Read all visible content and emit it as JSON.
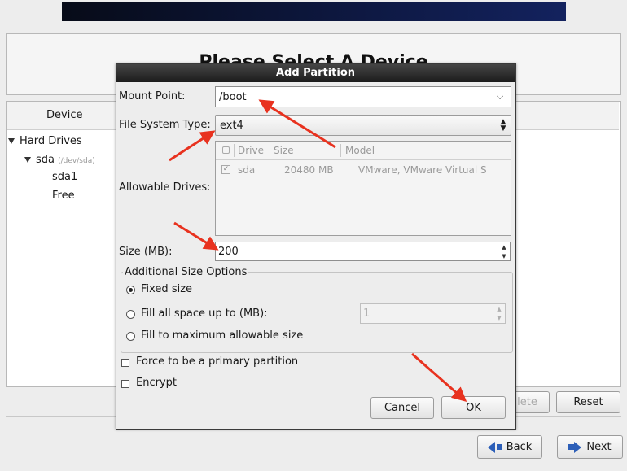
{
  "page": {
    "title": "Please Select A Device"
  },
  "device_panel": {
    "column_header": "Device",
    "tree": {
      "hard_drives": "Hard Drives",
      "disk": "sda",
      "disk_path": "(/dev/sda)",
      "partition": "sda1",
      "free": "Free"
    }
  },
  "background_buttons": {
    "delete": "lete",
    "reset": "Reset",
    "back": "Back",
    "next": "Next"
  },
  "dialog": {
    "title": "Add Partition",
    "mount_point_label": "Mount Point:",
    "mount_point_value": "/boot",
    "fs_type_label": "File System Type:",
    "fs_type_value": "ext4",
    "allowable_drives_label": "Allowable Drives:",
    "drives_table": {
      "columns": [
        "Drive",
        "Size",
        "Model"
      ],
      "rows": [
        {
          "checked": true,
          "drive": "sda",
          "size": "20480 MB",
          "model": "VMware, VMware Virtual S"
        }
      ]
    },
    "size_label": "Size (MB):",
    "size_value": "200",
    "additional_options_label": "Additional Size Options",
    "options": {
      "fixed": "Fixed size",
      "fill_up_to": "Fill all space up to (MB):",
      "fill_up_to_value": "1",
      "fill_max": "Fill to maximum allowable size",
      "selected": "fixed"
    },
    "force_primary_label": "Force to be a primary partition",
    "encrypt_label": "Encrypt",
    "force_primary_checked": false,
    "encrypt_checked": false,
    "cancel_label": "Cancel",
    "ok_label": "OK"
  },
  "icons": {
    "dropdown": "chevron-down-icon",
    "combo": "updown-icon",
    "back": "arrow-left-icon",
    "next": "arrow-right-icon"
  },
  "colors": {
    "annotation_arrow": "#e8321f",
    "dialog_titlebar": "#2a2a2a",
    "nav_arrow": "#2d5fb8"
  }
}
